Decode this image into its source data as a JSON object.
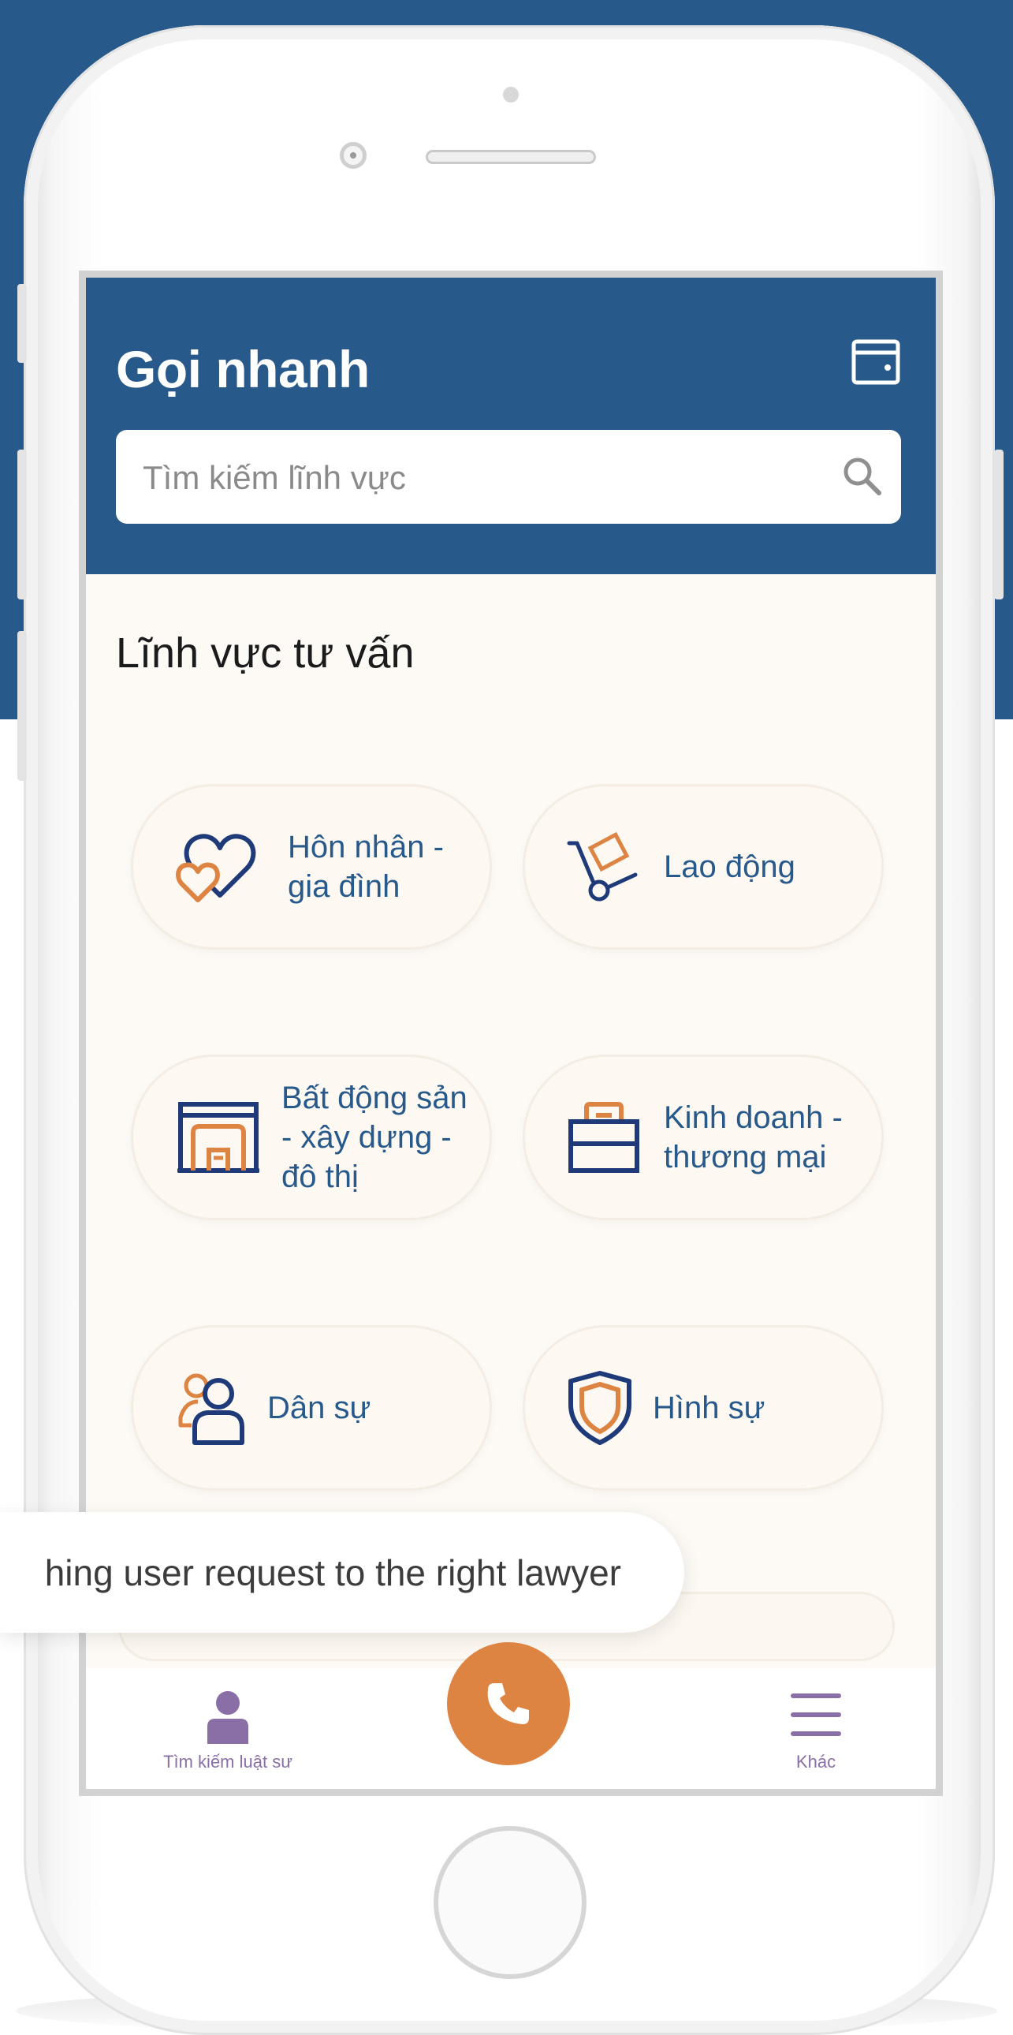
{
  "header": {
    "title": "Gọi nhanh"
  },
  "search": {
    "placeholder": "Tìm kiếm lĩnh vực"
  },
  "section": {
    "title": "Lĩnh vực tư vấn"
  },
  "categories": [
    {
      "label": "Hôn nhân - gia đình",
      "lines": [
        "Hôn nhân -",
        "gia đình"
      ],
      "icon": "heart-icon"
    },
    {
      "label": "Lao động",
      "lines": [
        "Lao động"
      ],
      "icon": "hand-truck-icon"
    },
    {
      "label": "Bất động sản - xây dựng - đô thị",
      "lines": [
        "Bất động sản",
        "- xây dựng -",
        "đô thị"
      ],
      "icon": "garage-icon"
    },
    {
      "label": "Kinh doanh - thương mại",
      "lines": [
        "Kinh doanh -",
        "thương mại"
      ],
      "icon": "briefcase-icon"
    },
    {
      "label": "Dân sự",
      "lines": [
        "Dân sự"
      ],
      "icon": "people-icon"
    },
    {
      "label": "Hình sự",
      "lines": [
        "Hình sự"
      ],
      "icon": "shield-icon"
    }
  ],
  "toast": {
    "text": "hing user request to the right lawyer"
  },
  "tabbar": {
    "left_label": "Tìm kiếm luật sư",
    "right_label": "Khác"
  },
  "colors": {
    "brand_blue": "#27598b",
    "accent_orange": "#de8443",
    "tab_purple": "#8a6ea6",
    "icon_navy": "#1f3a78"
  }
}
